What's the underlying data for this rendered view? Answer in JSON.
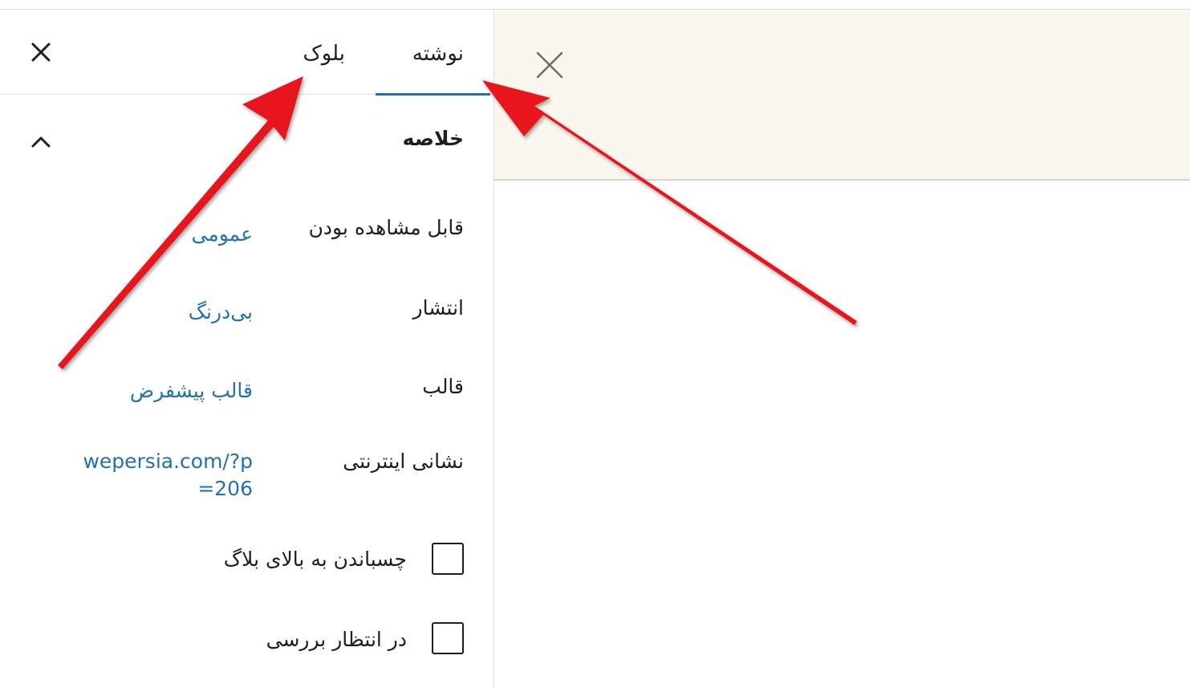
{
  "sidebar": {
    "tabs": [
      {
        "label": "نوشته",
        "active": true
      },
      {
        "label": "بلوک",
        "active": false
      }
    ],
    "close_icon": "close-icon",
    "section": {
      "title": "خلاصه",
      "toggle_icon": "chevron-up-icon",
      "rows": [
        {
          "label": "قابل مشاهده بودن",
          "value": "عمومی"
        },
        {
          "label": "انتشار",
          "value": "بی‌درنگ"
        },
        {
          "label": "قالب",
          "value": "قالب پیشفرض"
        },
        {
          "label": "نشانی اینترنتی",
          "value": "wepersia.com/?p=206"
        }
      ],
      "checkboxes": [
        {
          "label": "چسباندن به بالای بلاگ",
          "checked": false
        },
        {
          "label": "در انتظار بررسی",
          "checked": false
        }
      ]
    }
  },
  "notice": {
    "close_icon": "close-icon"
  },
  "colors": {
    "accent": "#2271b1",
    "arrow": "#e8141c",
    "notice_bg": "#faf7ee"
  }
}
